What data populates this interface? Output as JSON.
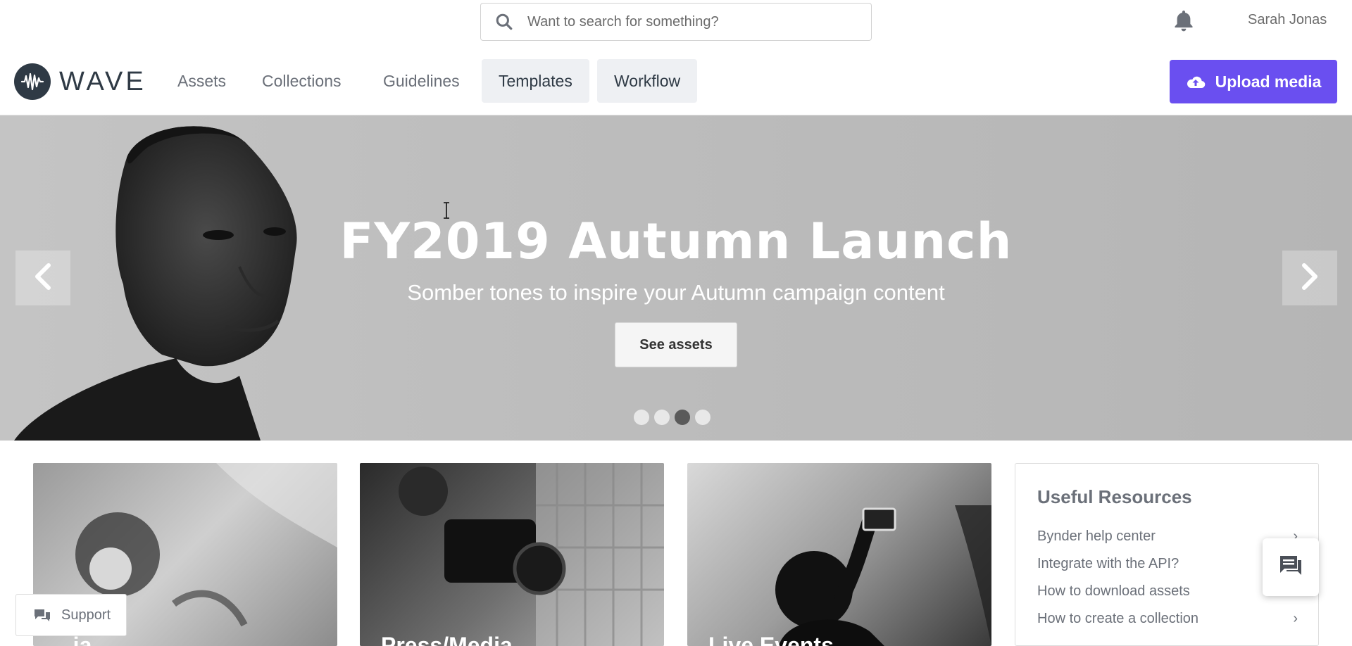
{
  "search": {
    "placeholder": "Want to search for something?"
  },
  "user": {
    "name": "Sarah Jonas"
  },
  "brand": {
    "name": "WAVE",
    "color": "#2f3a45"
  },
  "nav": {
    "items": [
      {
        "label": "Assets"
      },
      {
        "label": "Collections"
      },
      {
        "label": "Guidelines"
      },
      {
        "label": "Templates"
      },
      {
        "label": "Workflow"
      }
    ],
    "upload_label": "Upload media",
    "upload_color": "#6a4ff0"
  },
  "hero": {
    "title": "FY2019 Autumn Launch",
    "subtitle": "Somber tones to inspire your Autumn campaign content",
    "button_label": "See assets",
    "slide_count": 4,
    "active_slide": 3
  },
  "cards": [
    {
      "title": "...ia",
      "icon": "campaign-photo"
    },
    {
      "title": "Press/Media",
      "icon": "film-crew-photo"
    },
    {
      "title": "Live Events",
      "icon": "concert-photo"
    }
  ],
  "resources": {
    "title": "Useful Resources",
    "items": [
      {
        "label": "Bynder help center"
      },
      {
        "label": "Integrate with the API?"
      },
      {
        "label": "How to download assets"
      },
      {
        "label": "How to create a collection"
      }
    ]
  },
  "support": {
    "label": "Support"
  }
}
